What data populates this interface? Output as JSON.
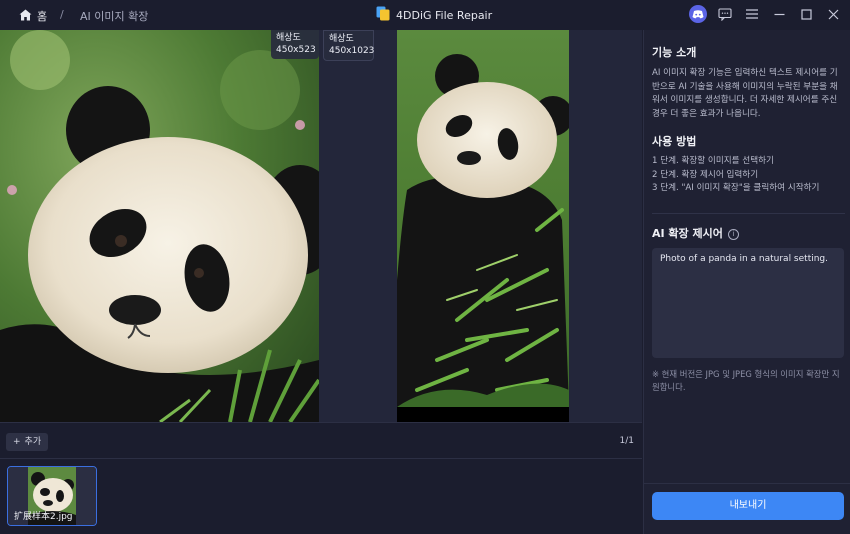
{
  "header": {
    "home_label": "홈",
    "separator": "/",
    "breadcrumb": "AI 이미지 확장",
    "app_title": "4DDiG File Repair"
  },
  "preview": {
    "original_badge": {
      "label": "해상도",
      "value": "450x523"
    },
    "expanded_badge": {
      "label": "해상도",
      "value": "450x1023"
    }
  },
  "toolbar": {
    "add_label": "추가",
    "page_counter": "1/1"
  },
  "thumbnail": {
    "file_name": "扩展样本2.jpg"
  },
  "panel": {
    "intro_title": "기능 소개",
    "intro_text": "AI 이미지 확장 기능은 입력하신 텍스트 제시어를 기반으로 AI 기술을 사용해 이미지의 누락된 부분을 채워서 이미지를 생성합니다. 더 자세한 제시어를 주신 경우 더 좋은 효과가 나옵니다.",
    "usage_title": "사용 방법",
    "steps": [
      "1 단계. 확장할 이미지를 선택하기",
      "2 단계. 확장 제시어 입력하기",
      "3 단계. \"AI 이미지 확장\"을 클릭하여 시작하기"
    ],
    "prompt_title": "AI 확장 제시어",
    "prompt_value": "Photo of a panda in a natural setting.",
    "note": "※ 현재 버전은 JPG 및 JPEG 형식의 이미지 확장만 지원합니다.",
    "export_label": "내보내기"
  },
  "icons": {
    "home": "home-icon",
    "app": "app-logo-icon",
    "discord": "discord-icon",
    "feedback": "feedback-icon",
    "menu": "menu-icon",
    "minimize": "minimize-icon",
    "maximize": "maximize-icon",
    "close": "close-icon",
    "info": "info-icon"
  },
  "colors": {
    "background": "#1b1d2e",
    "panel": "#1f2133",
    "accent": "#3d87f5",
    "discord": "#5b64e6"
  }
}
